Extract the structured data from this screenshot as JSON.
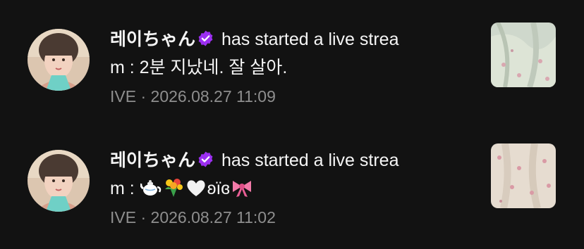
{
  "notifications": [
    {
      "username": "레이ちゃん",
      "action": "has started a live strea",
      "message_line2": "m : 2분 지났네. 잘 살아.",
      "message_prefix": "m : ",
      "message_emojis": [],
      "artist": "IVE",
      "separator": "·",
      "timestamp": "2026.08.27 11:09",
      "avatar_icon": "user-photo",
      "thumbnail_icon": "live-thumbnail"
    },
    {
      "username": "레이ちゃん",
      "action": "has started a live strea",
      "message_prefix": "m : ",
      "message_emojis": [
        "teapot-emoji",
        "bouquet-emoji",
        "white-heart-emoji"
      ],
      "message_text_after_emojis": "ʚïɞ",
      "message_trailing_emoji": "ribbon-emoji",
      "artist": "IVE",
      "separator": "·",
      "timestamp": "2026.08.27 11:02",
      "avatar_icon": "user-photo",
      "thumbnail_icon": "live-thumbnail"
    }
  ],
  "colors": {
    "background": "#121212",
    "text": "#f5f5f5",
    "meta": "#8e8e8e",
    "verified": "#9b2ff0"
  }
}
